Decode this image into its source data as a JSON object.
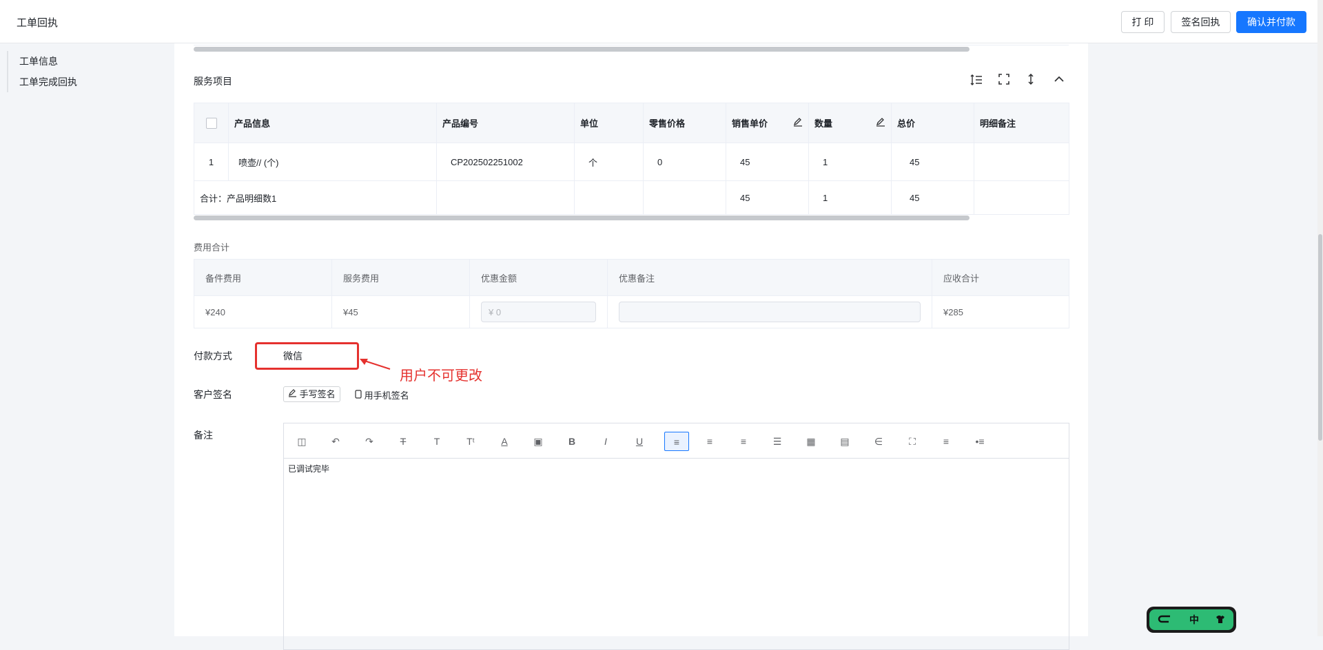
{
  "header": {
    "title": "工单回执",
    "print_label": "打 印",
    "sign_receipt_label": "签名回执",
    "confirm_pay_label": "确认并付款"
  },
  "sidebar": {
    "items": [
      {
        "label": "工单信息"
      },
      {
        "label": "工单完成回执"
      }
    ]
  },
  "service_items": {
    "title": "服务项目",
    "columns": [
      "产品信息",
      "产品编号",
      "单位",
      "零售价格",
      "销售单价",
      "数量",
      "总价",
      "明细备注"
    ],
    "rows": [
      {
        "index": "1",
        "product_info": "喷壶// (个)",
        "product_code": "CP202502251002",
        "unit": "个",
        "retail_price": "0",
        "sale_price": "45",
        "quantity": "1",
        "total": "45",
        "note": ""
      }
    ],
    "total_row": {
      "label": "合计：产品明细数1",
      "sale_price": "45",
      "quantity": "1",
      "total": "45"
    }
  },
  "fees": {
    "title": "费用合计",
    "headers": [
      "备件费用",
      "服务费用",
      "优惠金额",
      "优惠备注",
      "应收合计"
    ],
    "parts_fee": "¥240",
    "service_fee": "¥45",
    "discount_placeholder": "¥ 0",
    "discount_note": "",
    "receivable_total": "¥285"
  },
  "payment": {
    "label": "付款方式",
    "value": "微信",
    "annotation": "用户不可更改"
  },
  "signature": {
    "label": "客户签名",
    "handwrite_label": "手写签名",
    "phone_label": "用手机签名"
  },
  "remark": {
    "label": "备注",
    "content": "已调试完毕",
    "toolbar_icons": [
      "template-icon",
      "undo-icon",
      "redo-icon",
      "strikethrough-icon",
      "font-size-icon",
      "font-family-icon",
      "font-color-icon",
      "background-color-icon",
      "bold-icon",
      "italic-icon",
      "underline-icon",
      "align-left-icon",
      "align-center-icon",
      "align-right-icon",
      "align-justify-icon",
      "table-icon",
      "image-icon",
      "attachment-icon",
      "fullscreen-icon",
      "ordered-list-icon",
      "bullet-list-icon"
    ]
  },
  "ime": {
    "mode": "中"
  },
  "colors": {
    "primary": "#1677ff",
    "annotation_red": "#e5312e",
    "ime_green": "#2dbb74"
  }
}
